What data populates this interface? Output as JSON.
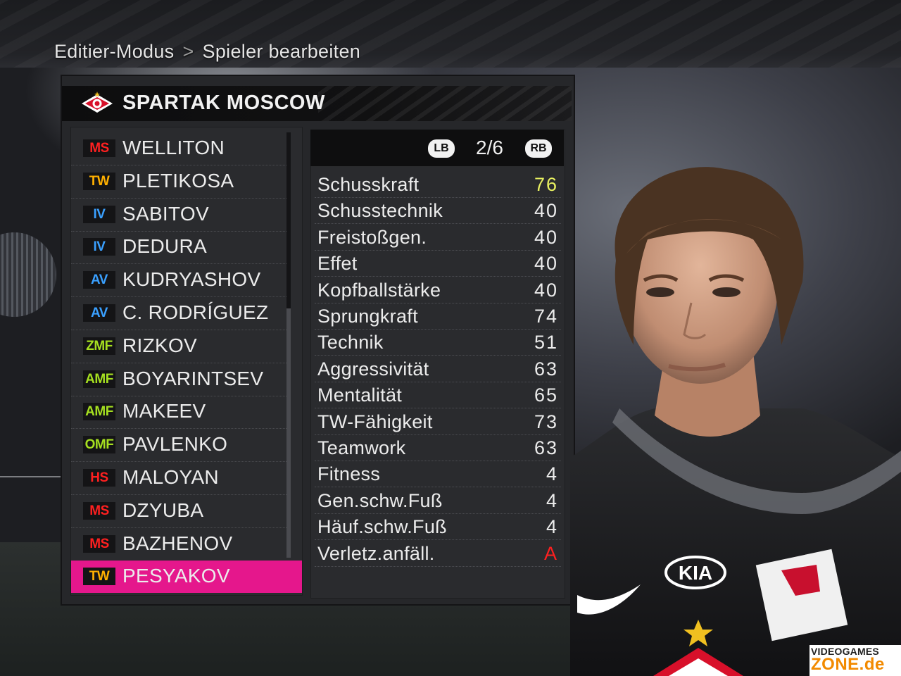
{
  "breadcrumb": {
    "mode": "Editier-Modus",
    "separator": ">",
    "page": "Spieler bearbeiten"
  },
  "team": {
    "name": "SPARTAK MOSCOW"
  },
  "players": [
    {
      "pos": "MS",
      "pos_color": "#ff2020",
      "name": "WELLITON"
    },
    {
      "pos": "TW",
      "pos_color": "#ffb000",
      "name": "PLETIKOSA"
    },
    {
      "pos": "IV",
      "pos_color": "#3aa0ff",
      "name": "SABITOV"
    },
    {
      "pos": "IV",
      "pos_color": "#3aa0ff",
      "name": "DEDURA"
    },
    {
      "pos": "AV",
      "pos_color": "#3aa0ff",
      "name": "KUDRYASHOV"
    },
    {
      "pos": "AV",
      "pos_color": "#3aa0ff",
      "name": "C. RODRÍGUEZ"
    },
    {
      "pos": "ZMF",
      "pos_color": "#a6e020",
      "name": "RIZKOV"
    },
    {
      "pos": "AMF",
      "pos_color": "#a6e020",
      "name": "BOYARINTSEV"
    },
    {
      "pos": "AMF",
      "pos_color": "#a6e020",
      "name": "MAKEEV"
    },
    {
      "pos": "OMF",
      "pos_color": "#a6e020",
      "name": "PAVLENKO"
    },
    {
      "pos": "HS",
      "pos_color": "#ff2020",
      "name": "MALOYAN"
    },
    {
      "pos": "MS",
      "pos_color": "#ff2020",
      "name": "DZYUBA"
    },
    {
      "pos": "MS",
      "pos_color": "#ff2020",
      "name": "BAZHENOV"
    },
    {
      "pos": "TW",
      "pos_color": "#ffb000",
      "name": "PESYAKOV"
    }
  ],
  "selected_index": 13,
  "stats_nav": {
    "prev": "LB",
    "page": "2/6",
    "next": "RB"
  },
  "stats": [
    {
      "label": "Schusskraft",
      "value": "76",
      "color": "#e8f060"
    },
    {
      "label": "Schusstechnik",
      "value": "40"
    },
    {
      "label": "Freistoßgen.",
      "value": "40"
    },
    {
      "label": "Effet",
      "value": "40"
    },
    {
      "label": "Kopfballstärke",
      "value": "40"
    },
    {
      "label": "Sprungkraft",
      "value": "74"
    },
    {
      "label": "Technik",
      "value": "51"
    },
    {
      "label": "Aggressivität",
      "value": "63"
    },
    {
      "label": "Mentalität",
      "value": "65"
    },
    {
      "label": "TW-Fähigkeit",
      "value": "73"
    },
    {
      "label": "Teamwork",
      "value": "63"
    },
    {
      "label": "Fitness",
      "value": "4"
    },
    {
      "label": "Gen.schw.Fuß",
      "value": "4"
    },
    {
      "label": "Häuf.schw.Fuß",
      "value": "4"
    },
    {
      "label": "Verletz.anfäll.",
      "value": "A",
      "color": "#ff2020"
    }
  ],
  "sponsor": {
    "name": "KIA"
  },
  "watermark": {
    "line1": "VIDEOGAMES",
    "line2": "ZONE.de"
  },
  "colors": {
    "accent": "#e5178c",
    "panel": "#2a2b2e"
  }
}
